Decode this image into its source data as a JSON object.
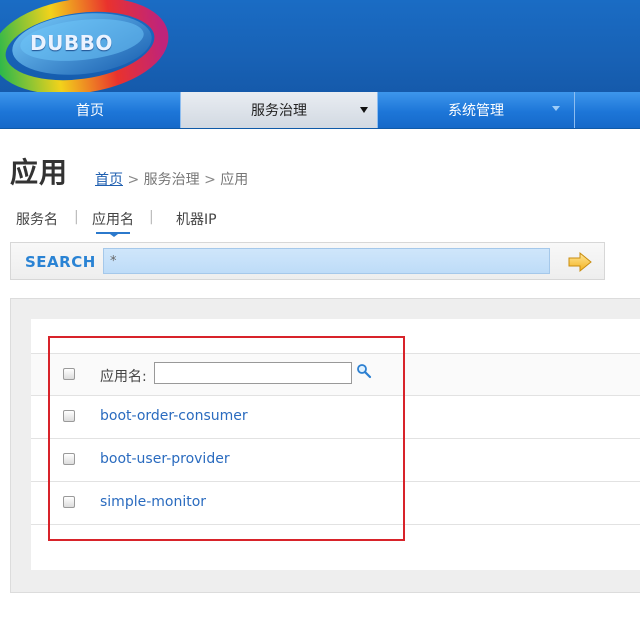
{
  "header": {
    "logo_text": "DUBBO"
  },
  "nav": {
    "items": [
      {
        "label": "首页"
      },
      {
        "label": "服务治理"
      },
      {
        "label": "系统管理"
      }
    ]
  },
  "page": {
    "title": "应用",
    "breadcrumb": {
      "home": "首页",
      "separator": ">",
      "section": "服务治理",
      "current": "应用"
    }
  },
  "subtabs": {
    "items": [
      {
        "label": "服务名"
      },
      {
        "label": "应用名",
        "selected": true
      },
      {
        "label": "机器IP"
      }
    ],
    "pipe": "|"
  },
  "search": {
    "label": "SEARCH",
    "value": "*"
  },
  "table": {
    "header_label": "应用名:",
    "filter_value": "",
    "rows": [
      {
        "name": "boot-order-consumer"
      },
      {
        "name": "boot-user-provider"
      },
      {
        "name": "simple-monitor"
      }
    ]
  },
  "colors": {
    "header_blue": "#1862b6",
    "nav_blue": "#1d76d8",
    "nav_active": "#d2d9e2",
    "link_blue": "#2a6bbf",
    "search_label": "#2a83d4",
    "highlight_red": "#d8232a"
  },
  "icons": {
    "search_go": "arrow-right-icon",
    "filter": "magnifier-icon"
  }
}
